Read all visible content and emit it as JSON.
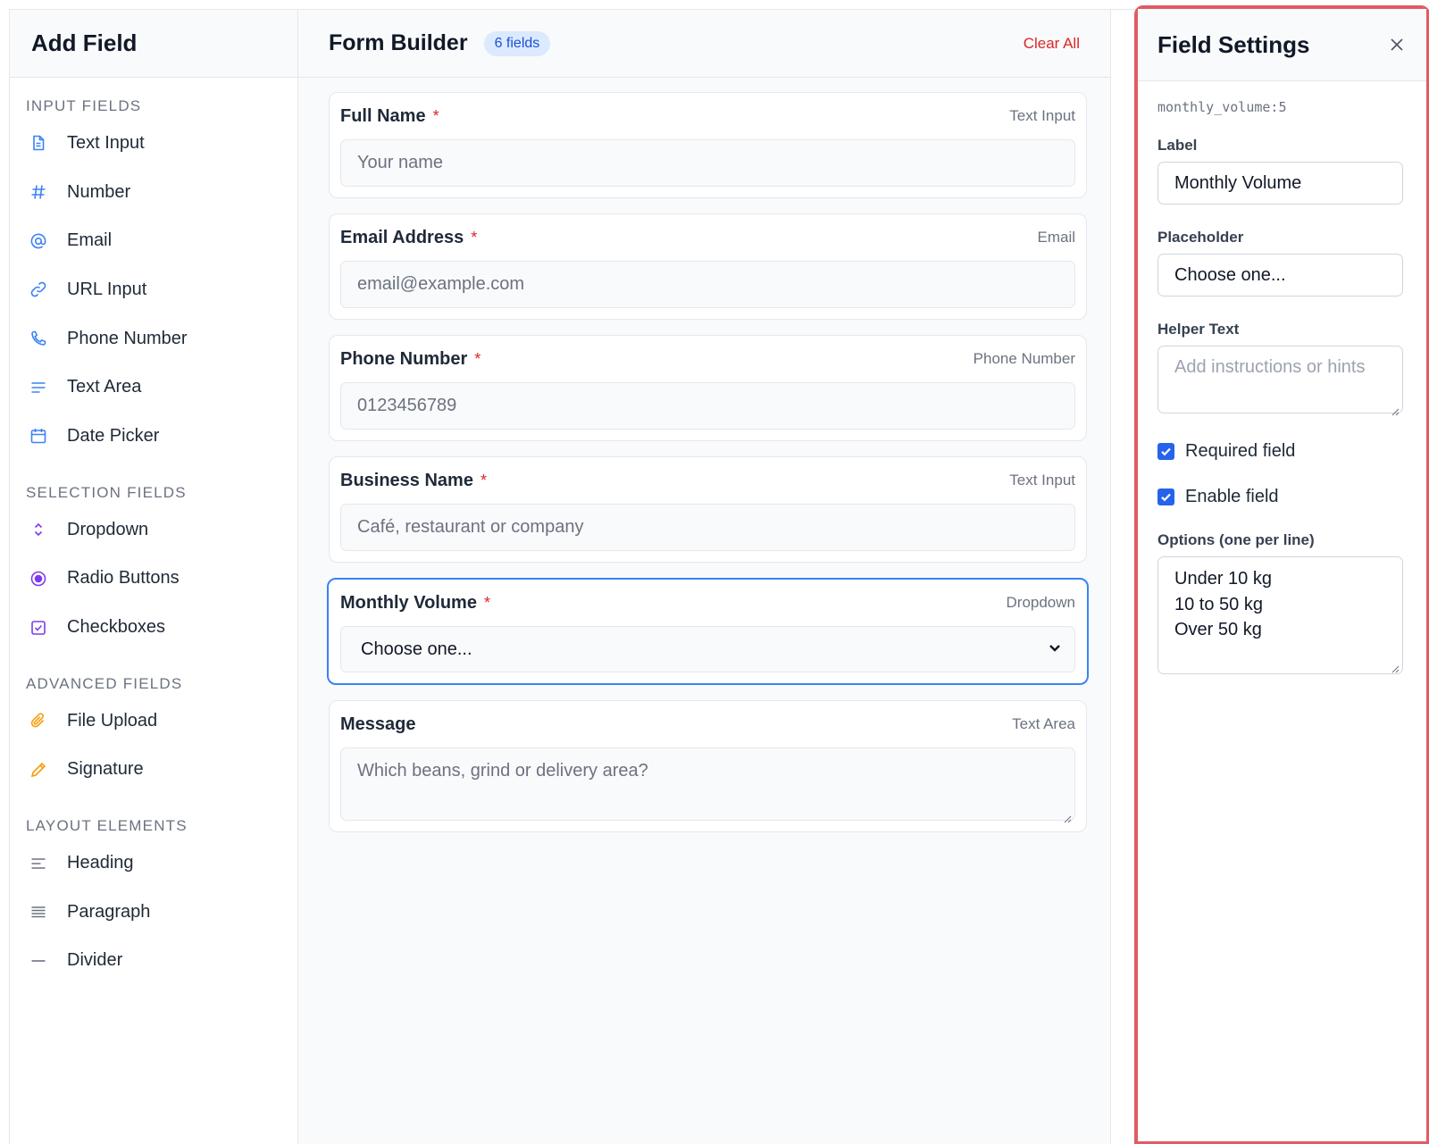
{
  "sidebar": {
    "title": "Add Field",
    "sections": {
      "input": {
        "title": "INPUT FIELDS",
        "items": [
          {
            "label": "Text Input",
            "icon": "document-icon"
          },
          {
            "label": "Number",
            "icon": "hash-icon"
          },
          {
            "label": "Email",
            "icon": "at-icon"
          },
          {
            "label": "URL Input",
            "icon": "link-icon"
          },
          {
            "label": "Phone Number",
            "icon": "phone-icon"
          },
          {
            "label": "Text Area",
            "icon": "lines-icon"
          },
          {
            "label": "Date Picker",
            "icon": "calendar-icon"
          }
        ]
      },
      "selection": {
        "title": "SELECTION FIELDS",
        "items": [
          {
            "label": "Dropdown",
            "icon": "chevron-updown-icon"
          },
          {
            "label": "Radio Buttons",
            "icon": "radio-icon"
          },
          {
            "label": "Checkboxes",
            "icon": "checkbox-icon"
          }
        ]
      },
      "advanced": {
        "title": "ADVANCED FIELDS",
        "items": [
          {
            "label": "File Upload",
            "icon": "paperclip-icon"
          },
          {
            "label": "Signature",
            "icon": "pencil-icon"
          }
        ]
      },
      "layout": {
        "title": "LAYOUT ELEMENTS",
        "items": [
          {
            "label": "Heading",
            "icon": "heading-icon"
          },
          {
            "label": "Paragraph",
            "icon": "paragraph-icon"
          },
          {
            "label": "Divider",
            "icon": "divider-icon"
          }
        ]
      }
    }
  },
  "builder": {
    "title": "Form Builder",
    "count_badge": "6 fields",
    "clear_label": "Clear All",
    "fields": [
      {
        "label": "Full Name",
        "required": "*",
        "type": "Text Input",
        "placeholder": "Your name"
      },
      {
        "label": "Email Address",
        "required": "*",
        "type": "Email",
        "placeholder": "email@example.com"
      },
      {
        "label": "Phone Number",
        "required": "*",
        "type": "Phone Number",
        "placeholder": "0123456789"
      },
      {
        "label": "Business Name",
        "required": "*",
        "type": "Text Input",
        "placeholder": "Café, restaurant or company"
      },
      {
        "label": "Monthly Volume",
        "required": "*",
        "type": "Dropdown",
        "value": "Choose one..."
      },
      {
        "label": "Message",
        "type": "Text Area",
        "placeholder": "Which beans, grind or delivery area?"
      }
    ]
  },
  "settings": {
    "title": "Field Settings",
    "field_id": "monthly_volume:5",
    "label_title": "Label",
    "label_value": "Monthly Volume",
    "placeholder_title": "Placeholder",
    "placeholder_value": "Choose one...",
    "helper_title": "Helper Text",
    "helper_placeholder": "Add instructions or hints",
    "required_label": "Required field",
    "required_checked": true,
    "enable_label": "Enable field",
    "enable_checked": true,
    "options_title": "Options (one per line)",
    "options": [
      "Under 10 kg",
      "10 to 50 kg",
      "Over 50 kg"
    ]
  },
  "colors": {
    "accent": "#3b82f6",
    "required": "#dc2626",
    "panel_highlight": "#e15b64",
    "badge_bg": "#dbeafe"
  }
}
